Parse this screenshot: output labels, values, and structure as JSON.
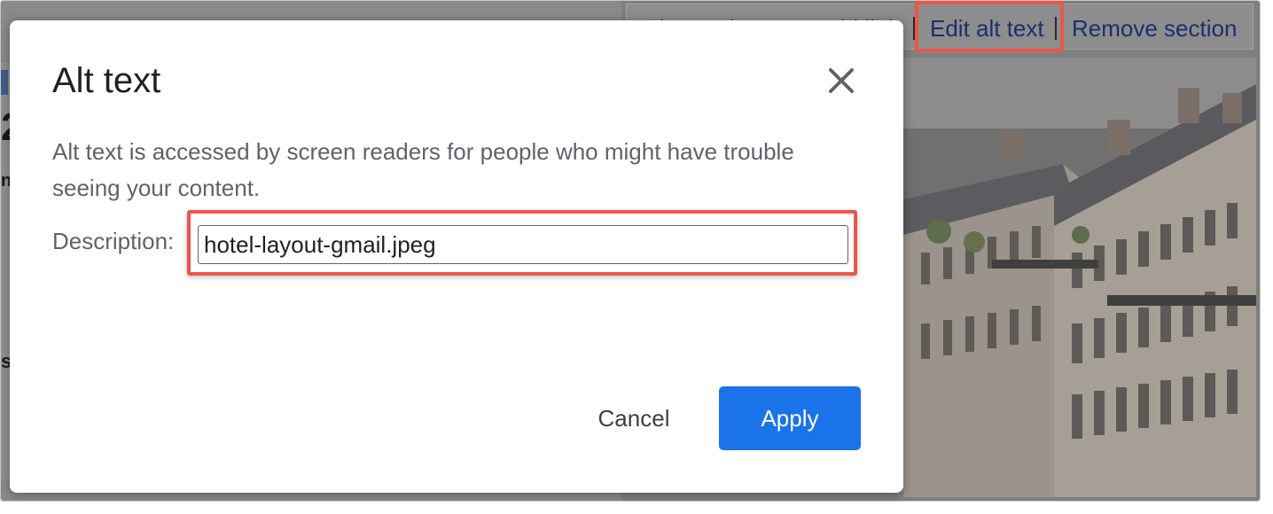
{
  "background": {
    "toolbar": {
      "change_image_label": "Change image",
      "add_link_label": "Add link",
      "edit_alt_text_label": "Edit alt text",
      "remove_section_label": "Remove section"
    },
    "page_glyphs": [
      "2",
      "n",
      "s"
    ]
  },
  "dialog": {
    "title": "Alt text",
    "description": "Alt text is accessed by screen readers for people who might have trouble seeing your content.",
    "field_label": "Description:",
    "field_value": "hotel-layout-gmail.jpeg",
    "cancel_label": "Cancel",
    "apply_label": "Apply",
    "close_icon": "close-icon"
  },
  "colors": {
    "apply_button": "#1a73e8",
    "highlight": "#e8574a",
    "toolbar_link": "#1b2f6e"
  }
}
